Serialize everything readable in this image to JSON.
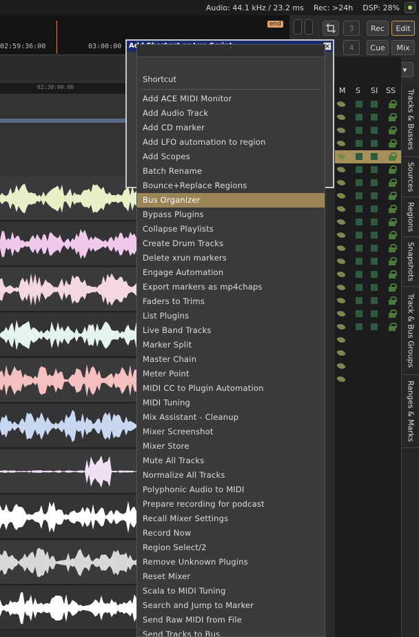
{
  "status": {
    "audio": "Audio: 44.1 kHz / 23.2 ms",
    "rec": "Rec: >24h",
    "dsp": "DSP: 28%"
  },
  "ruler": {
    "time1": "02:59:36:00",
    "time2": "03:00:00",
    "end_marker": "end",
    "minor_time": "02:30:00:00"
  },
  "toolbar": {
    "rec": "Rec",
    "edit": "Edit",
    "cue": "Cue",
    "mix": "Mix",
    "num3": "3",
    "num4": "4"
  },
  "dialog": {
    "title": "Add Shortcut or Lua Script",
    "close": "×"
  },
  "menu": {
    "arrow": "˄",
    "header": "Shortcut",
    "items": [
      "Add ACE MIDI Monitor",
      "Add Audio Track",
      "Add CD marker",
      "Add LFO automation to region",
      "Add Scopes",
      "Batch Rename",
      "Bounce+Replace Regions",
      "Bus Organizer",
      "Bypass Plugins",
      "Collapse Playlists",
      "Create Drum Tracks",
      "Delete xrun markers",
      "Engage Automation",
      "Export markers as mp4chaps",
      "Faders to Trims",
      "List Plugins",
      "Live Band Tracks",
      "Marker Split",
      "Master Chain",
      "Meter Point",
      "MIDI CC to Plugin Automation",
      "MIDI Tuning",
      "Mix Assistant - Cleanup",
      "Mixer Screenshot",
      "Mixer Store",
      "Mute All Tracks",
      "Normalize All Tracks",
      "Polyphonic Audio to MIDI",
      "Prepare recording for podcast",
      "Recall Mixer Settings",
      "Record Now",
      "Region Select/2",
      "Remove Unknown Plugins",
      "Reset Mixer",
      "Scala to MIDI Tuning",
      "Search and Jump to Marker",
      "Send Raw MIDI from File",
      "Send Tracks to Bus"
    ],
    "highlighted": "Bus Organizer"
  },
  "tracklist": {
    "columns": [
      "M",
      "S",
      "SI",
      "SS"
    ],
    "selected_row": 4,
    "row_count": 22
  },
  "sidetabs": [
    "Tracks & Busses",
    "Sources",
    "Regions",
    "Snapshots",
    "Track & Bus Groups",
    "Ranges & Marks"
  ],
  "tracks": [
    {
      "color": "#e8f0c8"
    },
    {
      "color": "#f0c8ec"
    },
    {
      "color": "#f4d8e0"
    },
    {
      "color": "#e4f4ec"
    },
    {
      "color": "#f4c0c0"
    },
    {
      "color": "#c8d8f0"
    },
    {
      "color": "#f0e0f4"
    },
    {
      "color": "#ffffff"
    },
    {
      "color": "#d8d8d8"
    },
    {
      "color": "#ffffff"
    }
  ]
}
